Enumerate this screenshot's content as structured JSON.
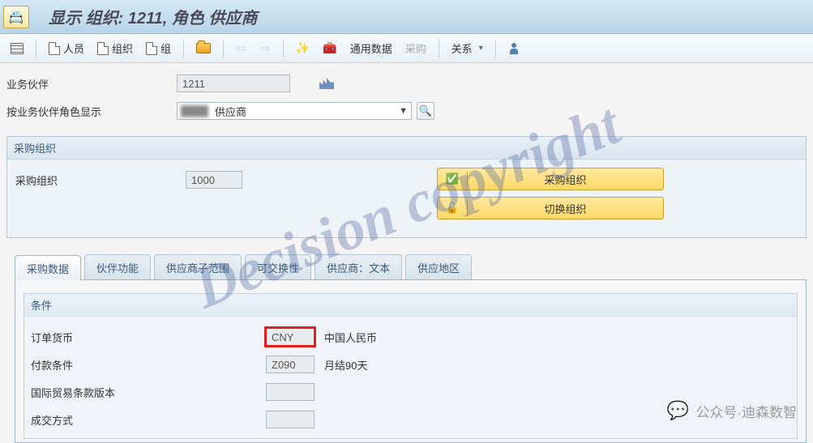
{
  "titlebar": {
    "title": "显示 组织: 1211, 角色 供应商"
  },
  "toolbar": {
    "person_label": "人员",
    "org_label": "组织",
    "group_label": "组",
    "general_data_label": "通用数据",
    "purchasing_label": "采购",
    "relations_label": "关系"
  },
  "header_form": {
    "partner_label": "业务伙伴",
    "partner_value": "1211",
    "role_label": "按业务伙伴角色显示",
    "role_value": "供应商"
  },
  "purchase_org_box": {
    "title": "采购组织",
    "field_label": "采购组织",
    "field_value": "1000",
    "btn1": "采购组织",
    "btn2": "切换组织"
  },
  "tabs": [
    {
      "label": "采购数据",
      "active": true
    },
    {
      "label": "伙伴功能",
      "active": false
    },
    {
      "label": "供应商子范围",
      "active": false
    },
    {
      "label": "可交换性",
      "active": false
    },
    {
      "label": "供应商：文本",
      "active": false
    },
    {
      "label": "供应地区",
      "active": false
    }
  ],
  "conditions_box": {
    "title": "条件",
    "rows": [
      {
        "label": "订单货币",
        "value": "CNY",
        "desc": "中国人民币",
        "highlight": true
      },
      {
        "label": "付款条件",
        "value": "Z090",
        "desc": "月结90天",
        "highlight": false
      },
      {
        "label": "国际贸易条款版本",
        "value": "",
        "desc": "",
        "highlight": false
      },
      {
        "label": "成交方式",
        "value": "",
        "desc": "",
        "highlight": false
      }
    ]
  },
  "watermark": "Decision copyright",
  "wechat_footer": "公众号·迪森数智"
}
